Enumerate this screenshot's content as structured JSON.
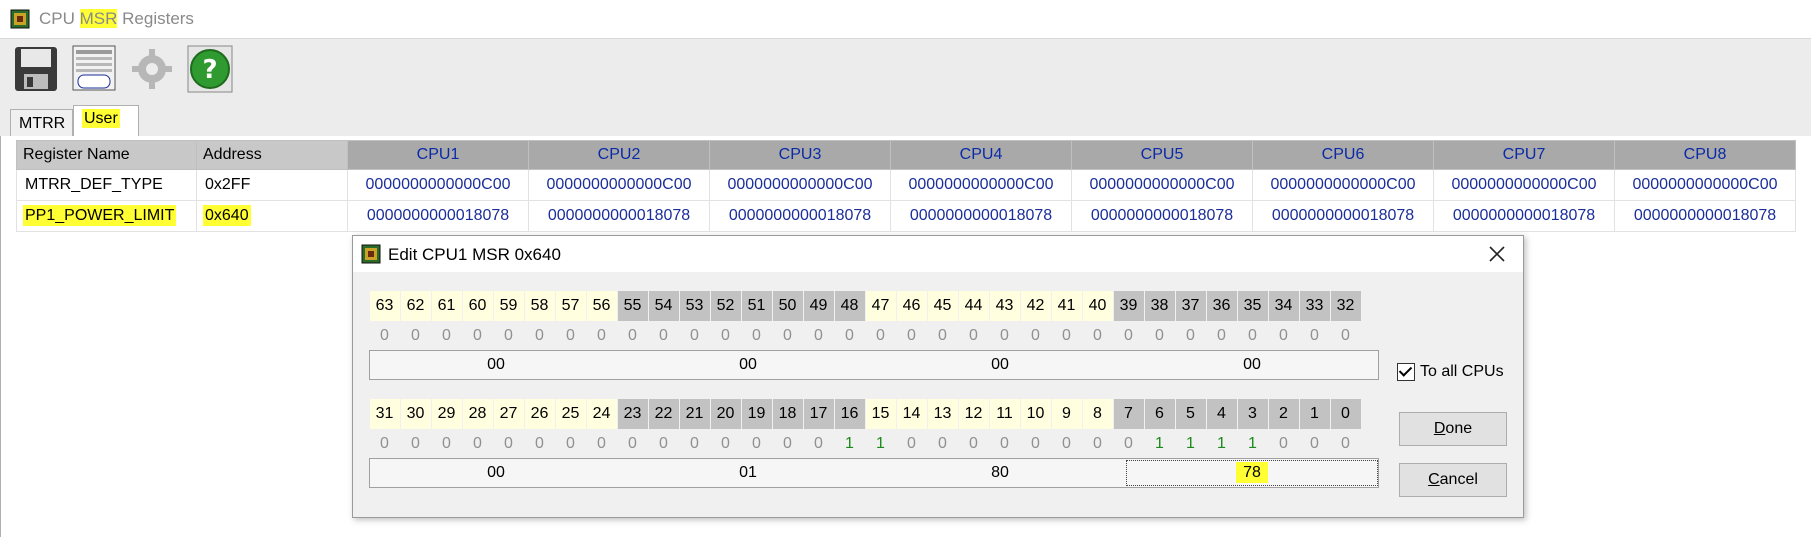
{
  "window": {
    "title_prefix": "CPU ",
    "title_highlight": "MSR",
    "title_suffix": " Registers"
  },
  "toolbar": {
    "buttons": [
      {
        "icon": "floppy-disk-icon"
      },
      {
        "icon": "user-list-icon",
        "label": "User"
      },
      {
        "icon": "gear-icon"
      },
      {
        "icon": "help-icon"
      }
    ]
  },
  "tabs": [
    {
      "label": "MTRR",
      "active": false
    },
    {
      "label": "User",
      "active": true
    }
  ],
  "grid": {
    "headers": [
      "Register Name",
      "Address",
      "CPU1",
      "CPU2",
      "CPU3",
      "CPU4",
      "CPU5",
      "CPU6",
      "CPU7",
      "CPU8"
    ],
    "rows": [
      {
        "name": "MTRR_DEF_TYPE",
        "address": "0x2FF",
        "values": [
          "0000000000000C00",
          "0000000000000C00",
          "0000000000000C00",
          "0000000000000C00",
          "0000000000000C00",
          "0000000000000C00",
          "0000000000000C00",
          "0000000000000C00"
        ]
      },
      {
        "name": "PP1_POWER_LIMIT",
        "address": "0x640",
        "values": [
          "0000000000018078",
          "0000000000018078",
          "0000000000018078",
          "0000000000018078",
          "0000000000018078",
          "0000000000018078",
          "0000000000018078",
          "0000000000018078"
        ]
      }
    ]
  },
  "dialog": {
    "title": "Edit CPU1 MSR 0x640",
    "high": {
      "bits": [
        "63",
        "62",
        "61",
        "60",
        "59",
        "58",
        "57",
        "56",
        "55",
        "54",
        "53",
        "52",
        "51",
        "50",
        "49",
        "48",
        "47",
        "46",
        "45",
        "44",
        "43",
        "42",
        "41",
        "40",
        "39",
        "38",
        "37",
        "36",
        "35",
        "34",
        "33",
        "32"
      ],
      "values": [
        "0",
        "0",
        "0",
        "0",
        "0",
        "0",
        "0",
        "0",
        "0",
        "0",
        "0",
        "0",
        "0",
        "0",
        "0",
        "0",
        "0",
        "0",
        "0",
        "0",
        "0",
        "0",
        "0",
        "0",
        "0",
        "0",
        "0",
        "0",
        "0",
        "0",
        "0",
        "0"
      ],
      "bytes": [
        "00",
        "00",
        "00",
        "00"
      ]
    },
    "low": {
      "bits": [
        "31",
        "30",
        "29",
        "28",
        "27",
        "26",
        "25",
        "24",
        "23",
        "22",
        "21",
        "20",
        "19",
        "18",
        "17",
        "16",
        "15",
        "14",
        "13",
        "12",
        "11",
        "10",
        "9",
        "8",
        "7",
        "6",
        "5",
        "4",
        "3",
        "2",
        "1",
        "0"
      ],
      "values": [
        "0",
        "0",
        "0",
        "0",
        "0",
        "0",
        "0",
        "0",
        "0",
        "0",
        "0",
        "0",
        "0",
        "0",
        "0",
        "1",
        "1",
        "0",
        "0",
        "0",
        "0",
        "0",
        "0",
        "0",
        "0",
        "1",
        "1",
        "1",
        "1",
        "0",
        "0",
        "0"
      ],
      "bytes": [
        "00",
        "01",
        "80",
        "78"
      ]
    },
    "checkbox_label": "To all CPUs",
    "checkbox_checked": true,
    "done_underline": "D",
    "done_rest": "one",
    "cancel_underline": "C",
    "cancel_rest": "ancel"
  },
  "colors": {
    "highlight": "#ffff33",
    "header_text": "#0a2aa8",
    "value_text": "#1a2e9a",
    "bit_on": "#1a8a1a"
  }
}
